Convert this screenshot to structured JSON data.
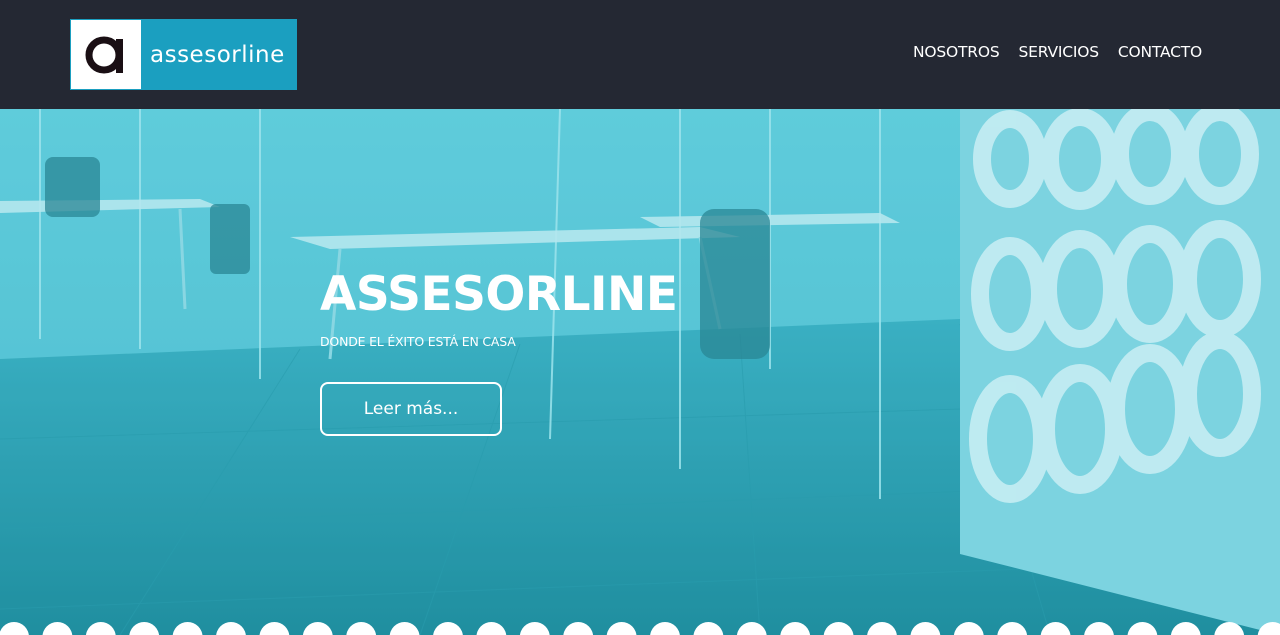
{
  "brand": {
    "logo_letter": "a",
    "name": "assesorline",
    "colors": {
      "header_bg": "#242833",
      "accent": "#1b9fc0",
      "hero_tint": "#4fc2d3"
    }
  },
  "nav": {
    "items": [
      {
        "label": "NOSOTROS"
      },
      {
        "label": "SERVICIOS"
      },
      {
        "label": "CONTACTO"
      }
    ]
  },
  "hero": {
    "title": "ASSESORLINE",
    "subtitle": "DONDE EL ÉXITO ESTÁ EN CASA",
    "cta_label": "Leer más..."
  }
}
